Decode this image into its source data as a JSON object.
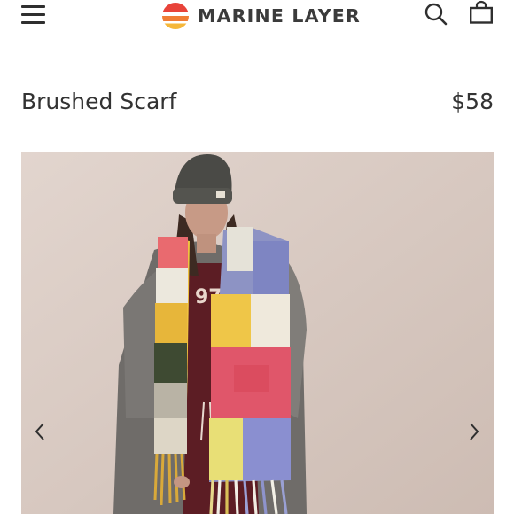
{
  "header": {
    "brand_name": "MARINE LAYER",
    "menu_icon": "hamburger-menu-icon",
    "search_icon": "search-icon",
    "bag_icon": "shopping-bag-icon",
    "logo_colors": [
      "#e8433a",
      "#f07d35",
      "#f5b73a"
    ]
  },
  "product": {
    "title": "Brushed Scarf",
    "price": "$58"
  },
  "gallery": {
    "image_description_icon": "product-photo",
    "prev_icon": "chevron-left-icon",
    "next_icon": "chevron-right-icon",
    "shirt_text": "97"
  },
  "colors": {
    "text": "#2f2f2f",
    "background": "#ffffff"
  }
}
